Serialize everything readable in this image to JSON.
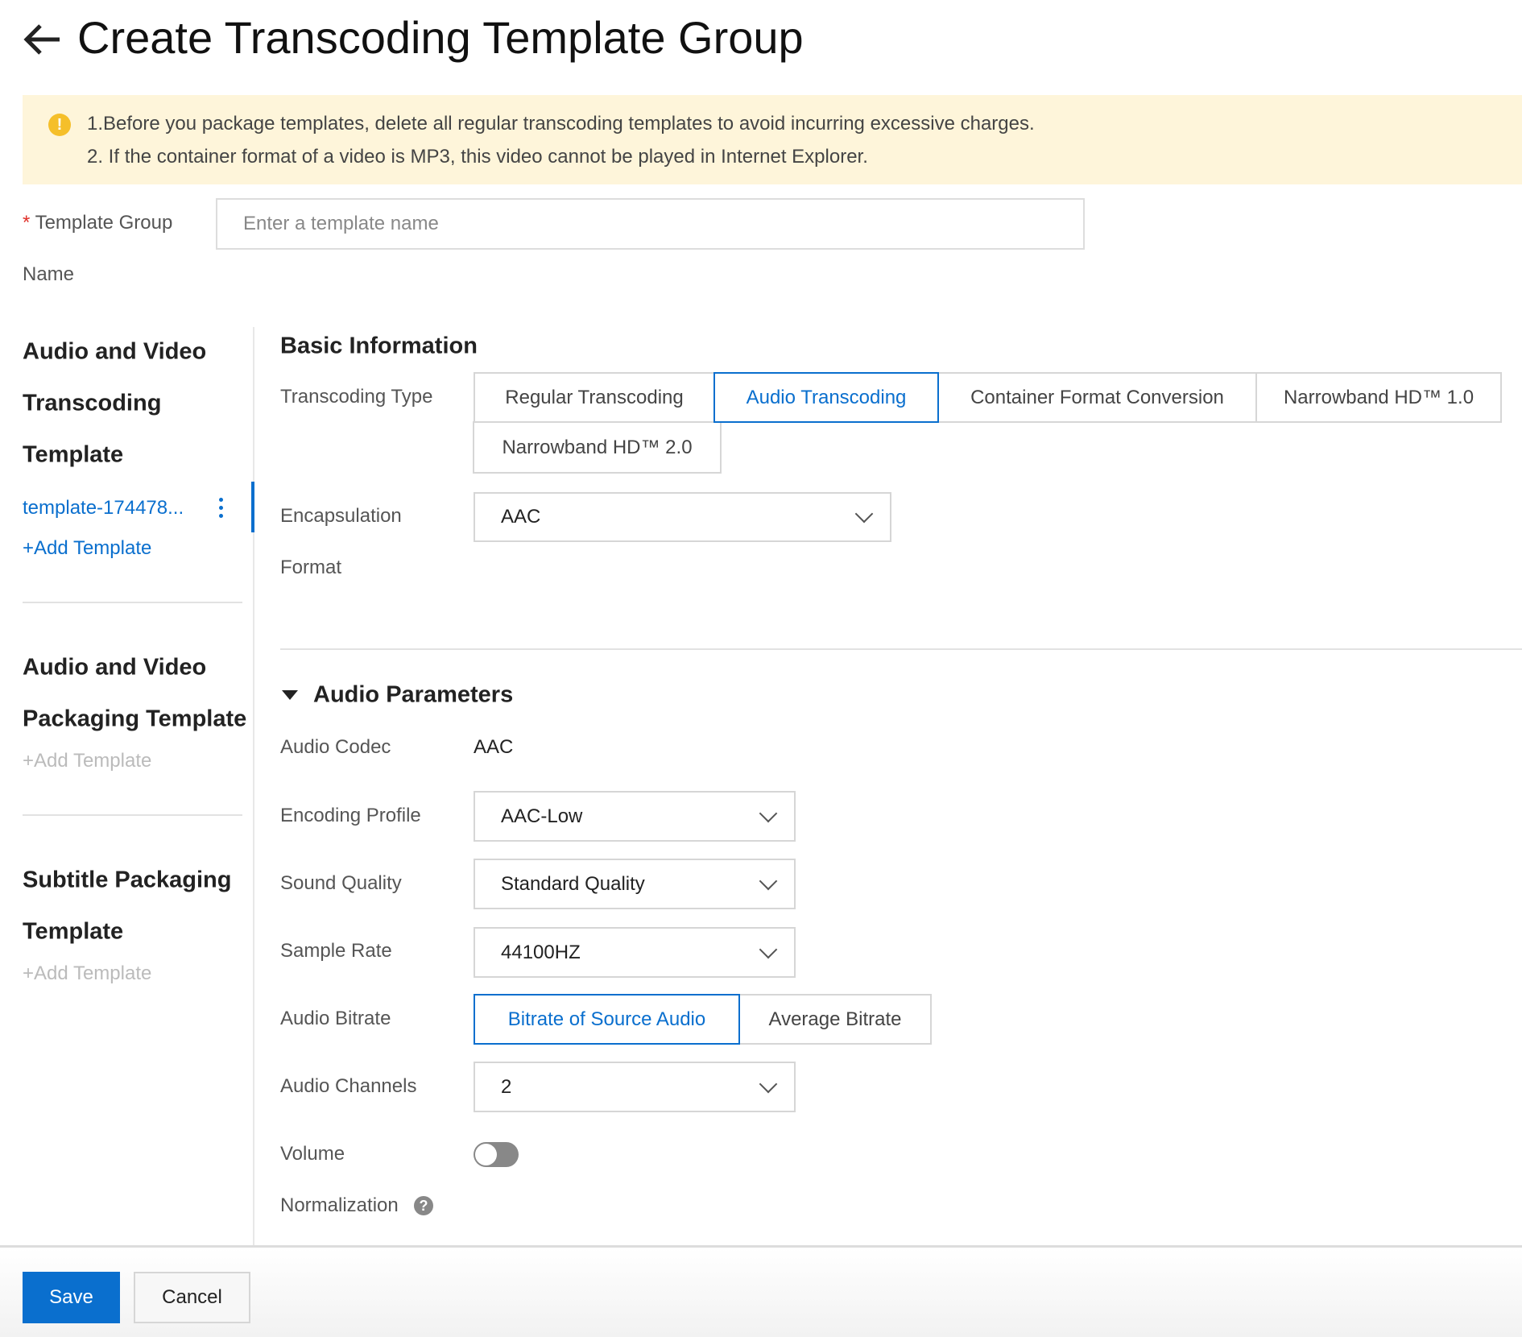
{
  "header": {
    "title": "Create Transcoding Template Group",
    "back_icon": "arrow-left-icon"
  },
  "notice": {
    "icon": "warning-icon",
    "lines": [
      "1.Before you package templates, delete all regular transcoding templates to avoid incurring excessive charges.",
      "2. If the container format of a video is MP3, this video cannot be played in Internet Explorer."
    ],
    "background": "#fef5da"
  },
  "group_name": {
    "required_mark": "*",
    "label_line1": "Template Group",
    "label_line2": "Name",
    "placeholder": "Enter a template name",
    "value": ""
  },
  "sidebar": {
    "sections": [
      {
        "title_lines": [
          "Audio and Video",
          "Transcoding",
          "Template"
        ],
        "items": [
          "template-174478..."
        ],
        "add_label": "+Add Template",
        "add_enabled": true
      },
      {
        "title_lines": [
          "Audio and Video",
          "Packaging Template"
        ],
        "items": [],
        "add_label": "+Add Template",
        "add_enabled": false
      },
      {
        "title_lines": [
          "Subtitle Packaging",
          "Template"
        ],
        "items": [],
        "add_label": "+Add Template",
        "add_enabled": false
      }
    ]
  },
  "basic": {
    "heading": "Basic Information",
    "type_label": "Transcoding Type",
    "types": [
      "Regular Transcoding",
      "Audio Transcoding",
      "Container Format Conversion",
      "Narrowband HD™ 1.0",
      "Narrowband HD™ 2.0"
    ],
    "selected_type": "Audio Transcoding",
    "format_label_line1": "Encapsulation",
    "format_label_line2": "Format",
    "format_value": "AAC"
  },
  "audio": {
    "heading": "Audio Parameters",
    "codec_label": "Audio Codec",
    "codec_value": "AAC",
    "profile_label": "Encoding Profile",
    "profile_value": "AAC-Low",
    "quality_label": "Sound Quality",
    "quality_value": "Standard Quality",
    "rate_label": "Sample Rate",
    "rate_value": "44100HZ",
    "bitrate_label": "Audio Bitrate",
    "bitrate_options": [
      "Bitrate of Source Audio",
      "Average Bitrate"
    ],
    "bitrate_selected": "Bitrate of Source Audio",
    "channels_label": "Audio Channels",
    "channels_value": "2",
    "volume_label": "Volume",
    "volume_enabled": false,
    "normalization_label": "Normalization",
    "help_icon": "question-icon"
  },
  "footer": {
    "save": "Save",
    "cancel": "Cancel"
  },
  "colors": {
    "accent": "#0a6fce"
  }
}
